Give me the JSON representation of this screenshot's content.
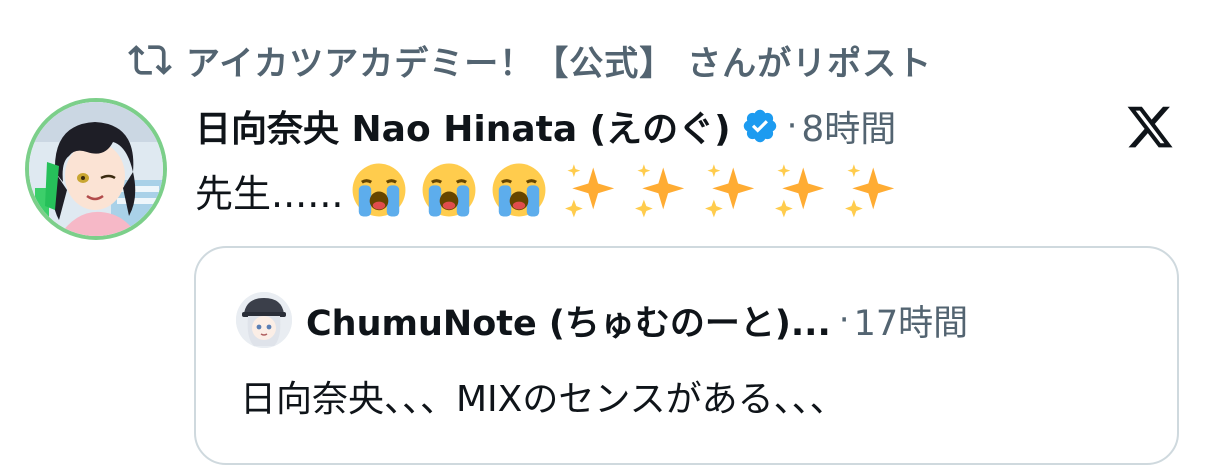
{
  "repost": {
    "text": "アイカツアカデミー！【公式】 さんがリポスト",
    "icon": "repost-icon"
  },
  "author": {
    "name": "日向奈央 Nao Hinata (えのぐ)",
    "verified": true,
    "separator": "·",
    "time": "8時間"
  },
  "post": {
    "text": "先生......",
    "emojis": [
      "loudly-crying-face",
      "loudly-crying-face",
      "loudly-crying-face",
      "sparkles",
      "sparkles",
      "sparkles",
      "sparkles",
      "sparkles"
    ]
  },
  "quoted": {
    "name": "ChumuNote (ちゅむのーと)...",
    "separator": "·",
    "time": "17時間",
    "text": "日向奈央、、、MIXのセンスがある、、、"
  },
  "colors": {
    "text_primary": "#0f1419",
    "text_secondary": "#536471",
    "verified_blue": "#1d9bf0",
    "border": "#cfd9de",
    "avatar_ring": "#7ccf8a"
  }
}
